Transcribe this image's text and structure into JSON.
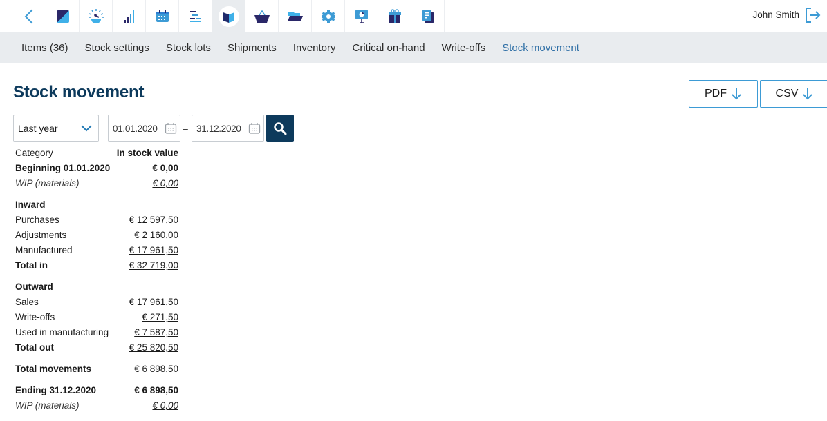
{
  "topbar": {
    "back_icon": "chevron-left-icon",
    "modules": [
      {
        "name": "dashboard",
        "icon": "square-split-icon",
        "active": false
      },
      {
        "name": "speed",
        "icon": "gauge-icon",
        "active": false
      },
      {
        "name": "stats",
        "icon": "signal-bars-icon",
        "active": false
      },
      {
        "name": "calendar",
        "icon": "calendar-icon",
        "active": false
      },
      {
        "name": "planning",
        "icon": "gantt-icon",
        "active": false
      },
      {
        "name": "stock",
        "icon": "box-icon",
        "active": true
      },
      {
        "name": "purchasing",
        "icon": "basket-icon",
        "active": false
      },
      {
        "name": "files",
        "icon": "folder-open-icon",
        "active": false
      },
      {
        "name": "settings",
        "icon": "gear-icon",
        "active": false
      },
      {
        "name": "presentation",
        "icon": "presentation-icon",
        "active": false
      },
      {
        "name": "gifts",
        "icon": "gift-icon",
        "active": false
      },
      {
        "name": "documents",
        "icon": "documents-icon",
        "active": false
      }
    ],
    "user_name": "John Smith",
    "logout_icon": "logout-icon"
  },
  "subnav": {
    "tabs": [
      {
        "label": "Items (36)",
        "active": false
      },
      {
        "label": "Stock settings",
        "active": false
      },
      {
        "label": "Stock lots",
        "active": false
      },
      {
        "label": "Shipments",
        "active": false
      },
      {
        "label": "Inventory",
        "active": false
      },
      {
        "label": "Critical on-hand",
        "active": false
      },
      {
        "label": "Write-offs",
        "active": false
      },
      {
        "label": "Stock movement",
        "active": true
      }
    ]
  },
  "page": {
    "title": "Stock movement",
    "export_pdf": "PDF",
    "export_csv": "CSV"
  },
  "filters": {
    "period": "Last year",
    "date_from": "01.01.2020",
    "date_separator": "–",
    "date_to": "31.12.2020"
  },
  "report": {
    "header": {
      "category": "Category",
      "value": "In stock value"
    },
    "beginning": {
      "label": "Beginning 01.01.2020",
      "value": "€ 0,00"
    },
    "beginning_wip": {
      "label": "WIP (materials)",
      "value": "€ 0,00"
    },
    "inward": {
      "title": "Inward",
      "rows": [
        {
          "label": "Purchases",
          "value": "€ 12 597,50"
        },
        {
          "label": "Adjustments",
          "value": "€ 2 160,00"
        },
        {
          "label": "Manufactured",
          "value": "€ 17 961,50"
        }
      ],
      "total": {
        "label": "Total in",
        "value": "€ 32 719,00"
      }
    },
    "outward": {
      "title": "Outward",
      "rows": [
        {
          "label": "Sales",
          "value": "€ 17 961,50"
        },
        {
          "label": "Write-offs",
          "value": "€ 271,50"
        },
        {
          "label": "Used in manufacturing",
          "value": "€ 7 587,50"
        }
      ],
      "total": {
        "label": "Total out",
        "value": "€ 25 820,50"
      }
    },
    "total_movements": {
      "label": "Total movements",
      "value": "€ 6 898,50"
    },
    "ending": {
      "label": "Ending 31.12.2020",
      "value": "€ 6 898,50"
    },
    "ending_wip": {
      "label": "WIP (materials)",
      "value": "€ 0,00"
    }
  },
  "colors": {
    "brand_dark": "#0d3a5c",
    "accent_blue": "#3d9bd5",
    "active_tab": "#2f6fa6",
    "subnav_bg": "#e9ecef"
  }
}
